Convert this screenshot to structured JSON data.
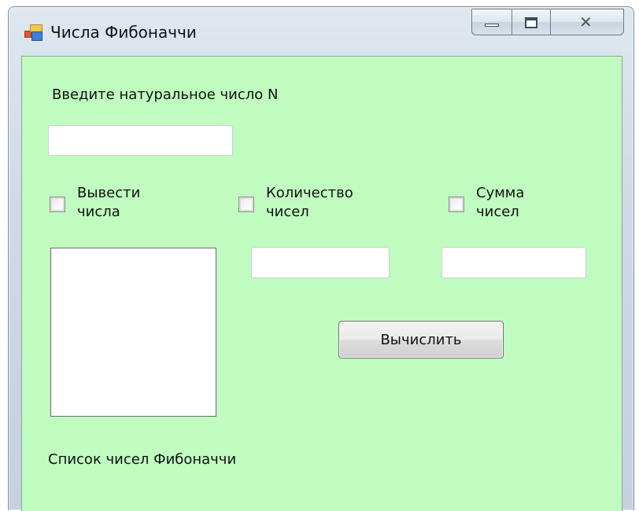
{
  "window": {
    "title": "Числа Фибоначчи",
    "icon": "winforms-app-icon"
  },
  "caption_buttons": {
    "minimize": "minimize-icon",
    "maximize": "maximize-icon",
    "close_glyph": "✕"
  },
  "form": {
    "prompt_label": "Введите натуральное число N",
    "n_input_value": "",
    "checkboxes": [
      {
        "line1": "Вывести",
        "line2": "числа",
        "checked": false
      },
      {
        "line1": "Количество",
        "line2": "чисел",
        "checked": false
      },
      {
        "line1": "Сумма",
        "line2": "чисел",
        "checked": false
      }
    ],
    "count_output_value": "",
    "sum_output_value": "",
    "list_items": [],
    "list_caption": "Список чисел Фибоначчи",
    "calculate_button": "Вычислить"
  },
  "colors": {
    "form_background": "#c0fcc0",
    "frame": "#cfdae6"
  }
}
